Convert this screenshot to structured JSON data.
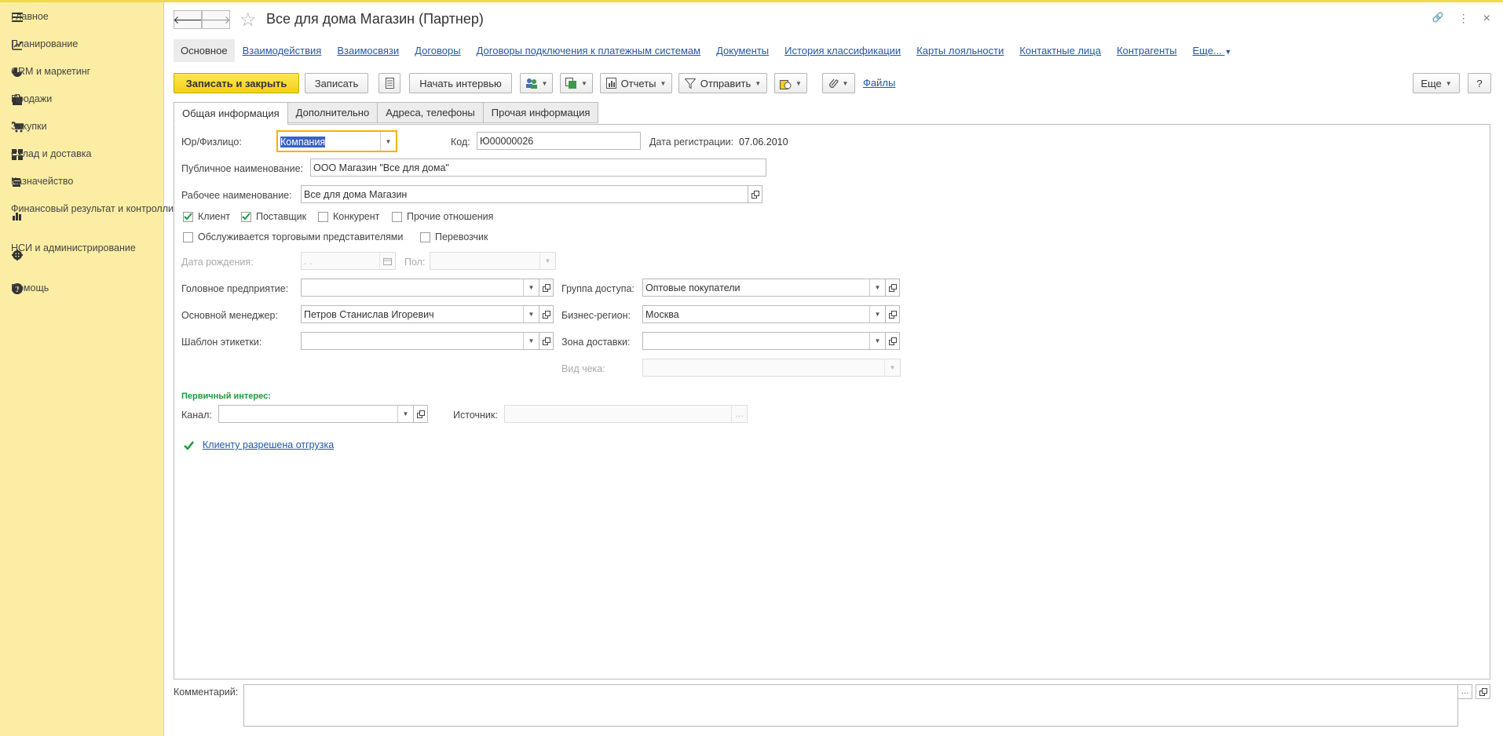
{
  "sidebar": {
    "items": [
      {
        "label": "Главное",
        "icon": "menu-icon"
      },
      {
        "label": "Планирование",
        "icon": "planning-icon"
      },
      {
        "label": "CRM и маркетинг",
        "icon": "pie-chart-icon"
      },
      {
        "label": "Продажи",
        "icon": "shopping-bag-icon"
      },
      {
        "label": "Закупки",
        "icon": "cart-icon"
      },
      {
        "label": "Склад и доставка",
        "icon": "warehouse-icon"
      },
      {
        "label": "Казначейство",
        "icon": "cash-icon"
      },
      {
        "label": "Финансовый результат и контроллинг",
        "icon": "bar-chart-icon"
      },
      {
        "label": "НСИ и администрирование",
        "icon": "gear-icon"
      },
      {
        "label": "Помощь",
        "icon": "help-icon"
      }
    ]
  },
  "header": {
    "title": "Все для дома Магазин (Партнер)",
    "back_glyph": "🡐",
    "forward_glyph": "🡒",
    "star_glyph": "☆",
    "link_glyph": "🔗",
    "more_glyph": "⋮",
    "close_glyph": "×"
  },
  "linkbar": {
    "active": "Основное",
    "links": [
      "Взаимодействия",
      "Взаимосвязи",
      "Договоры",
      "Договоры подключения к платежным системам",
      "Документы",
      "История классификации",
      "Карты лояльности",
      "Контактные лица",
      "Контрагенты",
      "Еще..."
    ]
  },
  "toolbar": {
    "save_close": "Записать и закрыть",
    "save": "Записать",
    "interview": "Начать интервью",
    "reports": "Отчеты",
    "send": "Отправить",
    "files": "Файлы",
    "more": "Еще",
    "help": "?"
  },
  "tabs": [
    "Общая информация",
    "Дополнительно",
    "Адреса, телефоны",
    "Прочая информация"
  ],
  "form": {
    "legal_type_label": "Юр/Физлицо:",
    "legal_type_value": "Компания",
    "code_label": "Код:",
    "code_value": "Ю00000026",
    "reg_date_label": "Дата регистрации:",
    "reg_date_value": "07.06.2010",
    "public_name_label": "Публичное наименование:",
    "public_name_value": "ООО Магазин \"Все для дома\"",
    "work_name_label": "Рабочее наименование:",
    "work_name_value": "Все для дома Магазин",
    "checkboxes_row1": [
      {
        "label": "Клиент",
        "checked": true
      },
      {
        "label": "Поставщик",
        "checked": true
      },
      {
        "label": "Конкурент",
        "checked": false
      },
      {
        "label": "Прочие отношения",
        "checked": false
      }
    ],
    "checkboxes_row2": [
      {
        "label": "Обслуживается торговыми представителями",
        "checked": false
      },
      {
        "label": "Перевозчик",
        "checked": false
      }
    ],
    "birth_date_label": "Дата рождения:",
    "birth_date_value": " .  .",
    "gender_label": "Пол:",
    "head_company_label": "Головное предприятие:",
    "head_company_value": "",
    "manager_label": "Основной менеджер:",
    "manager_value": "Петров Станислав Игоревич",
    "label_template_label": "Шаблон этикетки:",
    "label_template_value": "",
    "access_group_label": "Группа доступа:",
    "access_group_value": "Оптовые покупатели",
    "business_region_label": "Бизнес-регион:",
    "business_region_value": "Москва",
    "delivery_zone_label": "Зона доставки:",
    "delivery_zone_value": "",
    "receipt_type_label": "Вид чека:",
    "receipt_type_value": "",
    "primary_interest_header": "Первичный интерес:",
    "channel_label": "Канал:",
    "channel_value": "",
    "source_label": "Источник:",
    "source_value": "",
    "shipment_allowed": "Клиенту разрешена отгрузка",
    "comment_label": "Комментарий:"
  },
  "colors": {
    "sidebar_bg": "#fbeda4",
    "primary_button": "#f3cf1a",
    "link": "#2457a6",
    "green": "#1a9a3c",
    "focus": "#f0b400"
  }
}
